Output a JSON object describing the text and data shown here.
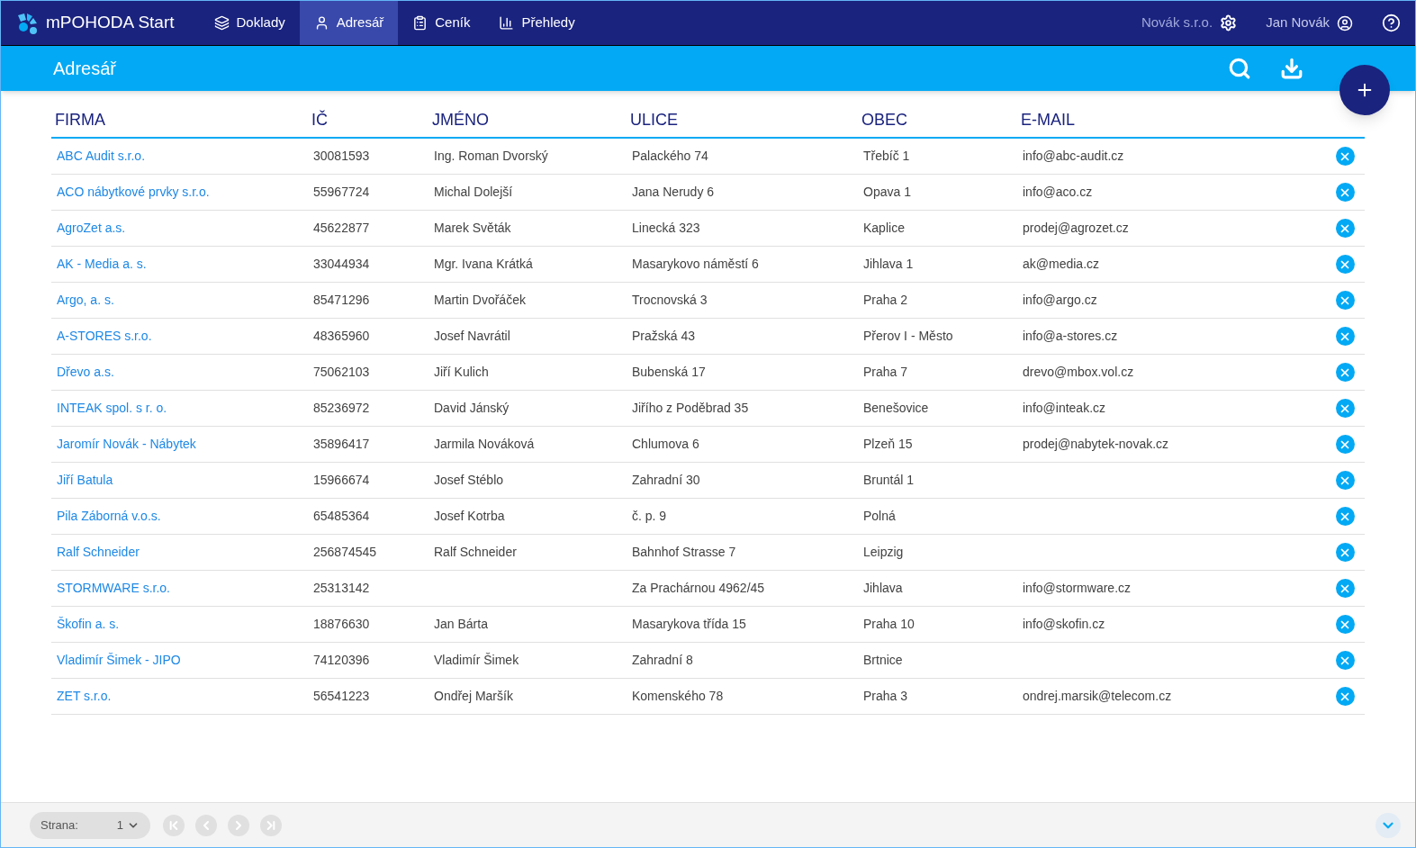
{
  "app": {
    "name": "mPOHODA Start"
  },
  "nav": [
    {
      "label": "Doklady",
      "selected": false
    },
    {
      "label": "Adresář",
      "selected": true
    },
    {
      "label": "Ceník",
      "selected": false
    },
    {
      "label": "Přehledy",
      "selected": false
    }
  ],
  "account": {
    "company": "Novák s.r.o.",
    "user": "Jan Novák"
  },
  "page_title": "Adresář",
  "table": {
    "columns": [
      "FIRMA",
      "IČ",
      "JMÉNO",
      "ULICE",
      "OBEC",
      "E-MAIL"
    ],
    "rows": [
      {
        "firma": "ABC Audit s.r.o.",
        "ic": "30081593",
        "jmeno": "Ing. Roman Dvorský",
        "ulice": "Palackého 74",
        "obec": "Třebíč 1",
        "email": "info@abc-audit.cz"
      },
      {
        "firma": "ACO nábytkové prvky s.r.o.",
        "ic": "55967724",
        "jmeno": "Michal Dolejší",
        "ulice": "Jana Nerudy 6",
        "obec": "Opava 1",
        "email": "info@aco.cz"
      },
      {
        "firma": "AgroZet a.s.",
        "ic": "45622877",
        "jmeno": "Marek Světák",
        "ulice": "Linecká 323",
        "obec": "Kaplice",
        "email": "prodej@agrozet.cz"
      },
      {
        "firma": "AK - Media a. s.",
        "ic": "33044934",
        "jmeno": "Mgr. Ivana Krátká",
        "ulice": "Masarykovo náměstí 6",
        "obec": "Jihlava 1",
        "email": "ak@media.cz"
      },
      {
        "firma": "Argo, a. s.",
        "ic": "85471296",
        "jmeno": "Martin Dvořáček",
        "ulice": "Trocnovská 3",
        "obec": "Praha 2",
        "email": "info@argo.cz"
      },
      {
        "firma": "A-STORES s.r.o.",
        "ic": "48365960",
        "jmeno": "Josef Navrátil",
        "ulice": "Pražská 43",
        "obec": "Přerov I - Město",
        "email": "info@a-stores.cz"
      },
      {
        "firma": "Dřevo a.s.",
        "ic": "75062103",
        "jmeno": "Jiří Kulich",
        "ulice": "Bubenská 17",
        "obec": "Praha 7",
        "email": "drevo@mbox.vol.cz"
      },
      {
        "firma": "INTEAK spol. s r. o.",
        "ic": "85236972",
        "jmeno": "David Jánský",
        "ulice": "Jiřího z Poděbrad 35",
        "obec": "Benešovice",
        "email": "info@inteak.cz"
      },
      {
        "firma": "Jaromír Novák - Nábytek",
        "ic": "35896417",
        "jmeno": "Jarmila Nováková",
        "ulice": "Chlumova 6",
        "obec": "Plzeň 15",
        "email": "prodej@nabytek-novak.cz"
      },
      {
        "firma": "Jiří Batula",
        "ic": "15966674",
        "jmeno": "Josef Stéblo",
        "ulice": "Zahradní 30",
        "obec": "Bruntál 1"
      },
      {
        "firma": "Pila Záborná v.o.s.",
        "ic": "65485364",
        "jmeno": "Josef Kotrba",
        "ulice": "č. p. 9",
        "obec": "Polná"
      },
      {
        "firma": "Ralf Schneider",
        "ic": "256874545",
        "jmeno": "Ralf Schneider",
        "ulice": "Bahnhof Strasse 7",
        "obec": "Leipzig"
      },
      {
        "firma": "STORMWARE s.r.o.",
        "ic": "25313142",
        "ulice": "Za Prachárnou 4962/45",
        "obec": "Jihlava",
        "email": "info@stormware.cz"
      },
      {
        "firma": "Škofin a. s.",
        "ic": "18876630",
        "jmeno": "Jan Bárta",
        "ulice": "Masarykova třída 15",
        "obec": "Praha 10",
        "email": "info@skofin.cz"
      },
      {
        "firma": "Vladimír Šimek - JIPO",
        "ic": "74120396",
        "jmeno": "Vladimír Šimek",
        "ulice": "Zahradní 8",
        "obec": "Brtnice"
      },
      {
        "firma": "ZET s.r.o.",
        "ic": "56541223",
        "jmeno": "Ondřej Maršík",
        "ulice": "Komenského 78",
        "obec": "Praha 3",
        "email": "ondrej.marsik@telecom.cz"
      }
    ]
  },
  "pager": {
    "label": "Strana:",
    "page": "1",
    "buttons": [
      {
        "kind": "first",
        "disabled": true
      },
      {
        "kind": "prev",
        "disabled": true
      },
      {
        "kind": "next",
        "disabled": true
      },
      {
        "kind": "last",
        "disabled": true
      }
    ]
  }
}
